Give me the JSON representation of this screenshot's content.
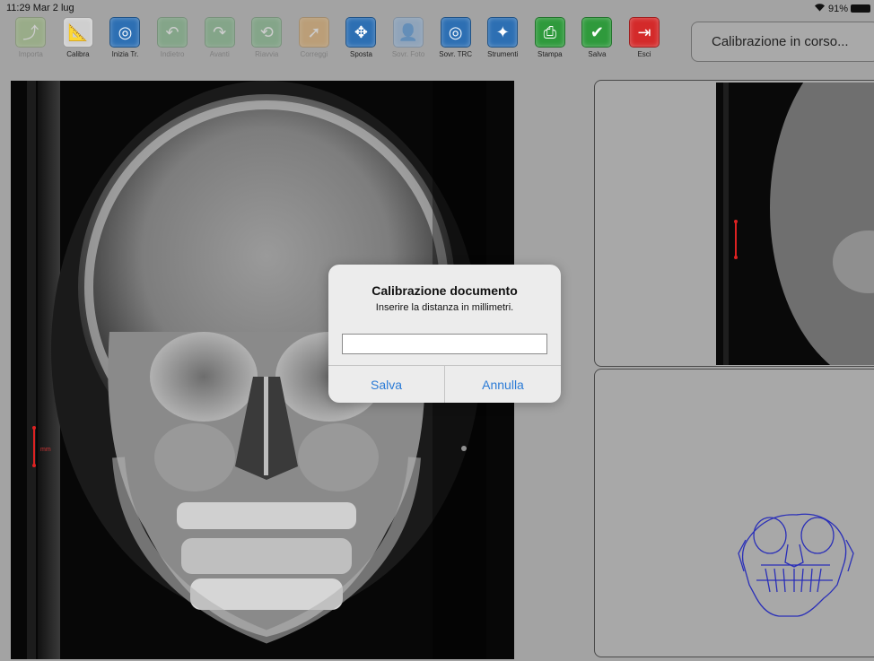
{
  "status_bar": {
    "time": "11:29  Mar 2 lug",
    "wifi_icon": "wifi-icon",
    "battery": "91%"
  },
  "toolbar": {
    "tools": [
      {
        "id": "importa",
        "label": "Importa",
        "icon": "import-icon",
        "glyph": "⤴",
        "color": "#8fb86a",
        "enabled": false
      },
      {
        "id": "calibra",
        "label": "Calibra",
        "icon": "calibrate-ruler-icon",
        "glyph": "📐",
        "color": "#cfcfcf",
        "enabled": true
      },
      {
        "id": "inizia",
        "label": "Inizia Tr.",
        "icon": "start-trace-icon",
        "glyph": "◎",
        "color": "#2d6fb3",
        "enabled": true
      },
      {
        "id": "indietro",
        "label": "Indietro",
        "icon": "undo-arrow-icon",
        "glyph": "↶",
        "color": "#5fa86a",
        "enabled": false
      },
      {
        "id": "avanti",
        "label": "Avanti",
        "icon": "redo-arrow-icon",
        "glyph": "↷",
        "color": "#5fa86a",
        "enabled": false
      },
      {
        "id": "riavvia",
        "label": "Riavvia",
        "icon": "restart-icon",
        "glyph": "⟲",
        "color": "#5fa86a",
        "enabled": false
      },
      {
        "id": "correggi",
        "label": "Correggi",
        "icon": "correct-pointer-icon",
        "glyph": "➚",
        "color": "#d99a45",
        "enabled": false
      },
      {
        "id": "sposta",
        "label": "Sposta",
        "icon": "move-arrows-icon",
        "glyph": "✥",
        "color": "#2d6fb3",
        "enabled": true
      },
      {
        "id": "sovr-foto",
        "label": "Sovr. Foto",
        "icon": "photo-overlay-icon",
        "glyph": "👤",
        "color": "#7aa6d6",
        "enabled": false
      },
      {
        "id": "sovr-trc",
        "label": "Sovr. TRC",
        "icon": "trace-overlay-icon",
        "glyph": "◎",
        "color": "#2d6fb3",
        "enabled": true
      },
      {
        "id": "strumenti",
        "label": "Strumenti",
        "icon": "magic-wand-icon",
        "glyph": "✦",
        "color": "#2d6fb3",
        "enabled": true
      },
      {
        "id": "stampa",
        "label": "Stampa",
        "icon": "printer-icon",
        "glyph": "⎙",
        "color": "#2f9a3c",
        "enabled": true
      },
      {
        "id": "salva",
        "label": "Salva",
        "icon": "save-check-icon",
        "glyph": "✔",
        "color": "#2f9a3c",
        "enabled": true
      },
      {
        "id": "esci",
        "label": "Esci",
        "icon": "exit-door-icon",
        "glyph": "⇥",
        "color": "#d42a2a",
        "enabled": true
      }
    ]
  },
  "status_box": {
    "text": "Calibrazione in corso..."
  },
  "dialog": {
    "title": "Calibrazione documento",
    "message": "Inserire la distanza in millimetri.",
    "input_value": "",
    "save_label": "Salva",
    "cancel_label": "Annulla"
  },
  "xray": {
    "calibration_unit": "mm"
  }
}
